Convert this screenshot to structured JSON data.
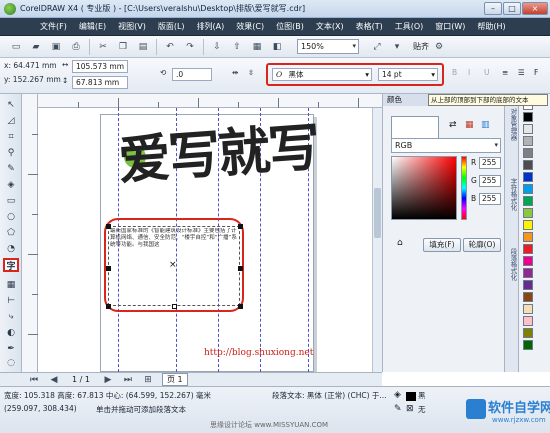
{
  "window": {
    "title": "CorelDRAW X4 ( 专业版 ) - [C:\\Users\\veralshu\\Desktop\\排版\\爱写就写.cdr]",
    "buttons": [
      "–",
      "□",
      "×"
    ]
  },
  "menu": {
    "items": [
      "文件(F)",
      "编辑(E)",
      "视图(V)",
      "版面(L)",
      "排列(A)",
      "效果(C)",
      "位图(B)",
      "文本(X)",
      "表格(T)",
      "工具(O)",
      "窗口(W)",
      "帮助(H)"
    ]
  },
  "toolbar": {
    "zoom_value": "150%",
    "snap_label": "贴齐"
  },
  "propbar": {
    "x": "x: 64.471 mm",
    "y": "y: 152.267 mm",
    "width": "105.573 mm",
    "height": "67.813 mm",
    "rotation": ".0",
    "font_name": "黑体",
    "font_size": "14 pt"
  },
  "docker": {
    "title": "颜色",
    "tooltip": "从上部的顶部到下部的底部的文本",
    "model": "RGB",
    "r_label": "R",
    "g_label": "G",
    "b_label": "B",
    "r": "255",
    "g": "255",
    "b": "255",
    "fill_button": "填充(F)",
    "outline_button": "轮廓(O)"
  },
  "docker_tabs": [
    "对象管理器",
    "字符格式化",
    "段落格式化"
  ],
  "canvas": {
    "headline": "爱写就写",
    "paragraph": "最新国家标准的《智能建筑设计标准》主要包括了计算机网络、通信、安全防范、“楼宇自控”和“广播”系统等功能。与我国这",
    "url": "http://blog.shuxiong.net"
  },
  "pagebar": {
    "page_counter": "1 / 1",
    "page_tab": "页 1"
  },
  "status": {
    "line1": "宽度: 105.318 高度: 67.813 中心: (64.599, 152.267) 毫米",
    "line2": "段落文本: 黑体 (正常) (CHC) 于...",
    "coords": "(259.097, 308.434)",
    "hint": "单击并拖动可添加段落文本",
    "fill_label": "黑",
    "outline_label": "无"
  },
  "watermark": {
    "brand": "软件自学网",
    "url": "www.rjzxw.com",
    "forum": "思缘设计论坛 www.MISSYUAN.COM"
  },
  "colors": {
    "menubar_bg": "#2c3e50",
    "highlight_red": "#d9261c",
    "guide_blue": "#4f52c9",
    "url_red": "#c8211b"
  },
  "palette": [
    "#ffffff",
    "#000000",
    "#e6e6e6",
    "#b3b3b3",
    "#808080",
    "#4d4d4d",
    "#0033cc",
    "#00a0e9",
    "#00a651",
    "#8dc63f",
    "#fff200",
    "#f7941d",
    "#ed1c24",
    "#ec008c",
    "#92278f",
    "#662d91",
    "#8b4513",
    "#f5deb3",
    "#ffc0cb",
    "#808000",
    "#006400"
  ]
}
